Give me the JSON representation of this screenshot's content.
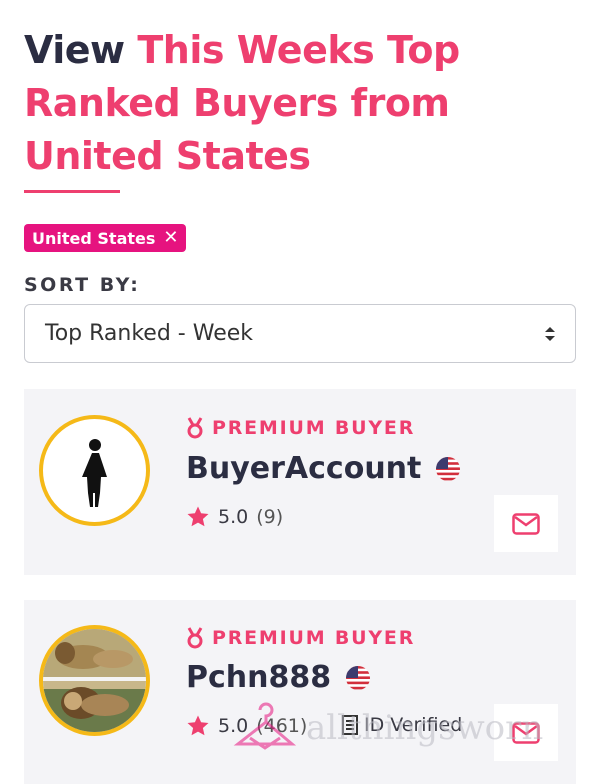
{
  "heading": {
    "lead": "View",
    "accent": "This Weeks Top Ranked Buyers from United States"
  },
  "filter_chip": {
    "label": "United States",
    "remove_glyph": "✕"
  },
  "sort": {
    "label": "SORT BY:",
    "selected": "Top Ranked - Week"
  },
  "colors": {
    "accent": "#ee3f6f",
    "chip": "#e6137f",
    "avatar_border": "#f5b918",
    "card_bg": "#f4f4f7"
  },
  "buyers": [
    {
      "badge": "PREMIUM BUYER",
      "name": "BuyerAccount",
      "rating": "5.0",
      "reviews": "(9)",
      "avatar": "female-silhouette-icon",
      "flag": "us-flag-icon"
    },
    {
      "badge": "PREMIUM BUYER",
      "name": "Pchn888",
      "rating": "5.0",
      "reviews": "(461)",
      "verified": "ID Verified",
      "avatar": "lions-photo",
      "flag": "us-flag-icon"
    }
  ],
  "watermark": {
    "text": "allthingsworn"
  }
}
